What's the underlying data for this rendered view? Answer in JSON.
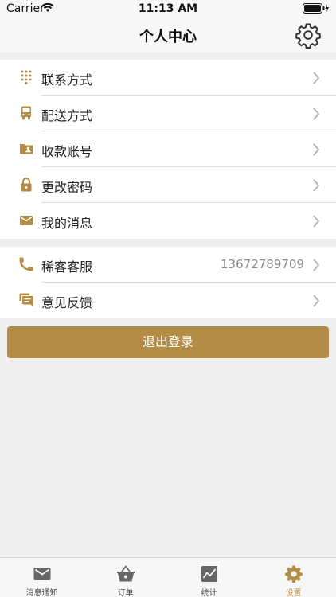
{
  "status_bar": {
    "carrier": "Carrier",
    "time": "11:13 AM"
  },
  "nav": {
    "title": "个人中心",
    "settings_icon": "gear-icon"
  },
  "group1": [
    {
      "label": "联系方式",
      "icon": "dialpad-icon"
    },
    {
      "label": "配送方式",
      "icon": "bus-icon"
    },
    {
      "label": "收款账号",
      "icon": "account-folder-icon"
    },
    {
      "label": "更改密码",
      "icon": "lock-icon"
    },
    {
      "label": "我的消息",
      "icon": "mail-icon"
    }
  ],
  "group2": [
    {
      "label": "稀客客服",
      "value": "13672789709",
      "icon": "phone-icon"
    },
    {
      "label": "意见反馈",
      "icon": "feedback-icon"
    }
  ],
  "logout_label": "退出登录",
  "tabs": [
    {
      "label": "消息通知",
      "icon": "mail-icon"
    },
    {
      "label": "订单",
      "icon": "basket-icon"
    },
    {
      "label": "统计",
      "icon": "chart-icon"
    },
    {
      "label": "设置",
      "icon": "gear-icon",
      "active": true
    }
  ],
  "colors": {
    "accent": "#b38c46",
    "background": "#efefef",
    "tab_inactive": "#666666"
  }
}
